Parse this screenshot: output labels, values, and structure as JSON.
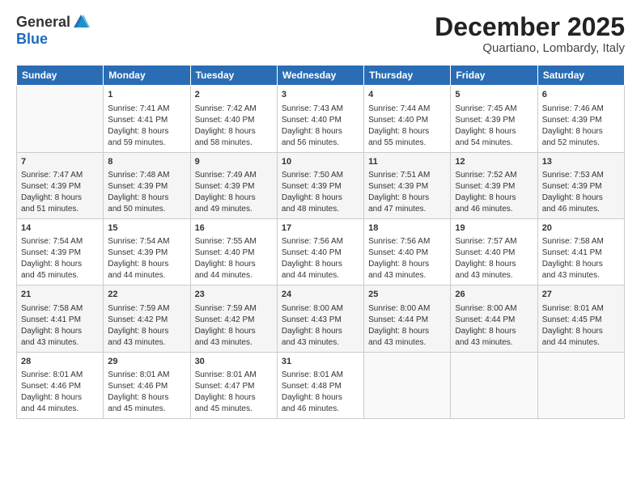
{
  "logo": {
    "general": "General",
    "blue": "Blue"
  },
  "header": {
    "month": "December 2025",
    "location": "Quartiano, Lombardy, Italy"
  },
  "days_of_week": [
    "Sunday",
    "Monday",
    "Tuesday",
    "Wednesday",
    "Thursday",
    "Friday",
    "Saturday"
  ],
  "weeks": [
    [
      {
        "day": "",
        "info": ""
      },
      {
        "day": "1",
        "info": "Sunrise: 7:41 AM\nSunset: 4:41 PM\nDaylight: 8 hours\nand 59 minutes."
      },
      {
        "day": "2",
        "info": "Sunrise: 7:42 AM\nSunset: 4:40 PM\nDaylight: 8 hours\nand 58 minutes."
      },
      {
        "day": "3",
        "info": "Sunrise: 7:43 AM\nSunset: 4:40 PM\nDaylight: 8 hours\nand 56 minutes."
      },
      {
        "day": "4",
        "info": "Sunrise: 7:44 AM\nSunset: 4:40 PM\nDaylight: 8 hours\nand 55 minutes."
      },
      {
        "day": "5",
        "info": "Sunrise: 7:45 AM\nSunset: 4:39 PM\nDaylight: 8 hours\nand 54 minutes."
      },
      {
        "day": "6",
        "info": "Sunrise: 7:46 AM\nSunset: 4:39 PM\nDaylight: 8 hours\nand 52 minutes."
      }
    ],
    [
      {
        "day": "7",
        "info": "Sunrise: 7:47 AM\nSunset: 4:39 PM\nDaylight: 8 hours\nand 51 minutes."
      },
      {
        "day": "8",
        "info": "Sunrise: 7:48 AM\nSunset: 4:39 PM\nDaylight: 8 hours\nand 50 minutes."
      },
      {
        "day": "9",
        "info": "Sunrise: 7:49 AM\nSunset: 4:39 PM\nDaylight: 8 hours\nand 49 minutes."
      },
      {
        "day": "10",
        "info": "Sunrise: 7:50 AM\nSunset: 4:39 PM\nDaylight: 8 hours\nand 48 minutes."
      },
      {
        "day": "11",
        "info": "Sunrise: 7:51 AM\nSunset: 4:39 PM\nDaylight: 8 hours\nand 47 minutes."
      },
      {
        "day": "12",
        "info": "Sunrise: 7:52 AM\nSunset: 4:39 PM\nDaylight: 8 hours\nand 46 minutes."
      },
      {
        "day": "13",
        "info": "Sunrise: 7:53 AM\nSunset: 4:39 PM\nDaylight: 8 hours\nand 46 minutes."
      }
    ],
    [
      {
        "day": "14",
        "info": "Sunrise: 7:54 AM\nSunset: 4:39 PM\nDaylight: 8 hours\nand 45 minutes."
      },
      {
        "day": "15",
        "info": "Sunrise: 7:54 AM\nSunset: 4:39 PM\nDaylight: 8 hours\nand 44 minutes."
      },
      {
        "day": "16",
        "info": "Sunrise: 7:55 AM\nSunset: 4:40 PM\nDaylight: 8 hours\nand 44 minutes."
      },
      {
        "day": "17",
        "info": "Sunrise: 7:56 AM\nSunset: 4:40 PM\nDaylight: 8 hours\nand 44 minutes."
      },
      {
        "day": "18",
        "info": "Sunrise: 7:56 AM\nSunset: 4:40 PM\nDaylight: 8 hours\nand 43 minutes."
      },
      {
        "day": "19",
        "info": "Sunrise: 7:57 AM\nSunset: 4:40 PM\nDaylight: 8 hours\nand 43 minutes."
      },
      {
        "day": "20",
        "info": "Sunrise: 7:58 AM\nSunset: 4:41 PM\nDaylight: 8 hours\nand 43 minutes."
      }
    ],
    [
      {
        "day": "21",
        "info": "Sunrise: 7:58 AM\nSunset: 4:41 PM\nDaylight: 8 hours\nand 43 minutes."
      },
      {
        "day": "22",
        "info": "Sunrise: 7:59 AM\nSunset: 4:42 PM\nDaylight: 8 hours\nand 43 minutes."
      },
      {
        "day": "23",
        "info": "Sunrise: 7:59 AM\nSunset: 4:42 PM\nDaylight: 8 hours\nand 43 minutes."
      },
      {
        "day": "24",
        "info": "Sunrise: 8:00 AM\nSunset: 4:43 PM\nDaylight: 8 hours\nand 43 minutes."
      },
      {
        "day": "25",
        "info": "Sunrise: 8:00 AM\nSunset: 4:44 PM\nDaylight: 8 hours\nand 43 minutes."
      },
      {
        "day": "26",
        "info": "Sunrise: 8:00 AM\nSunset: 4:44 PM\nDaylight: 8 hours\nand 43 minutes."
      },
      {
        "day": "27",
        "info": "Sunrise: 8:01 AM\nSunset: 4:45 PM\nDaylight: 8 hours\nand 44 minutes."
      }
    ],
    [
      {
        "day": "28",
        "info": "Sunrise: 8:01 AM\nSunset: 4:46 PM\nDaylight: 8 hours\nand 44 minutes."
      },
      {
        "day": "29",
        "info": "Sunrise: 8:01 AM\nSunset: 4:46 PM\nDaylight: 8 hours\nand 45 minutes."
      },
      {
        "day": "30",
        "info": "Sunrise: 8:01 AM\nSunset: 4:47 PM\nDaylight: 8 hours\nand 45 minutes."
      },
      {
        "day": "31",
        "info": "Sunrise: 8:01 AM\nSunset: 4:48 PM\nDaylight: 8 hours\nand 46 minutes."
      },
      {
        "day": "",
        "info": ""
      },
      {
        "day": "",
        "info": ""
      },
      {
        "day": "",
        "info": ""
      }
    ]
  ]
}
